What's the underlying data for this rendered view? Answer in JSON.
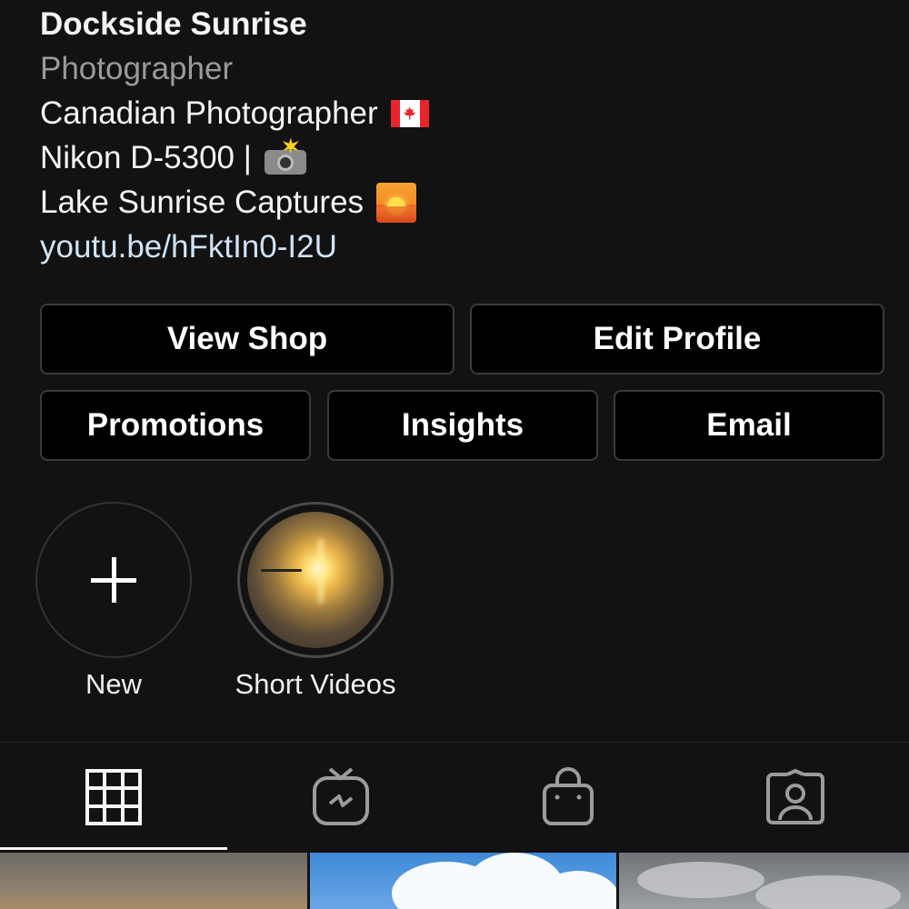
{
  "profile": {
    "name": "Dockside Sunrise",
    "category": "Photographer",
    "bio": [
      "Canadian Photographer",
      "Nikon D-5300 |",
      "Lake Sunrise Captures"
    ],
    "bio_emoji_icons": [
      "canada-flag-icon",
      "camera-with-flash-icon",
      "sunrise-icon"
    ],
    "link": "youtu.be/hFktIn0-I2U"
  },
  "buttons": {
    "view_shop": "View Shop",
    "edit_profile": "Edit Profile",
    "promotions": "Promotions",
    "insights": "Insights",
    "email": "Email"
  },
  "highlights": [
    {
      "label": "New",
      "icon": "plus-icon"
    },
    {
      "label": "Short Videos",
      "cover": "lake-sunrise"
    }
  ],
  "tabs": [
    {
      "icon": "grid-icon",
      "active": true
    },
    {
      "icon": "igtv-icon",
      "active": false
    },
    {
      "icon": "shopping-bag-icon",
      "active": false
    },
    {
      "icon": "tagged-person-icon",
      "active": false
    }
  ],
  "colors": {
    "background": "#121212",
    "button_bg": "#000000",
    "button_border": "#3a3a3a",
    "link": "#cfe3f6",
    "muted_text": "#9a9a9a"
  }
}
